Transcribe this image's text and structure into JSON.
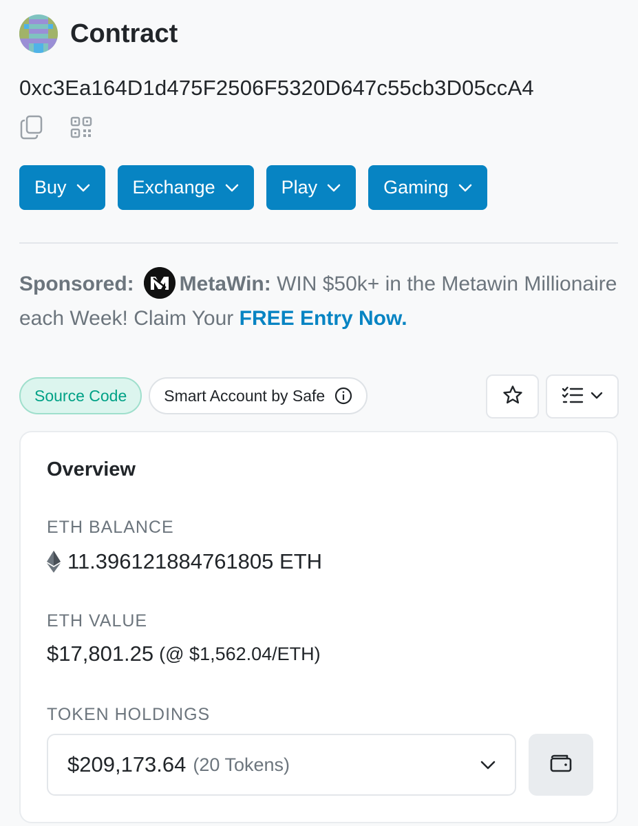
{
  "header": {
    "title": "Contract",
    "avatar_icon": "identicon"
  },
  "address": "0xc3Ea164D1d475F2506F5320D647c55cb3D05ccA4",
  "address_actions": [
    {
      "icon": "copy-icon"
    },
    {
      "icon": "qr-code-icon"
    }
  ],
  "nav_buttons": [
    {
      "label": "Buy"
    },
    {
      "label": "Exchange"
    },
    {
      "label": "Play"
    },
    {
      "label": "Gaming"
    }
  ],
  "sponsored": {
    "prefix": "Sponsored:",
    "brand": "MetaWin:",
    "text": " WIN $50k+ in the Metawin Millionaire each Week! Claim Your ",
    "cta": "FREE Entry Now."
  },
  "pills": {
    "source_code": "Source Code",
    "smart_account": "Smart Account by Safe"
  },
  "overview": {
    "title": "Overview",
    "eth_balance_label": "ETH BALANCE",
    "eth_balance_value": "11.396121884761805 ETH",
    "eth_value_label": "ETH VALUE",
    "eth_value_amount": "$17,801.25",
    "eth_value_rate": "(@ $1,562.04/ETH)",
    "token_holdings_label": "TOKEN HOLDINGS",
    "token_holdings_amount": "$209,173.64",
    "token_holdings_count": "(20 Tokens)"
  },
  "colors": {
    "primary": "#0784c3",
    "source_code_green": "#00a186",
    "muted": "#6c757d"
  }
}
